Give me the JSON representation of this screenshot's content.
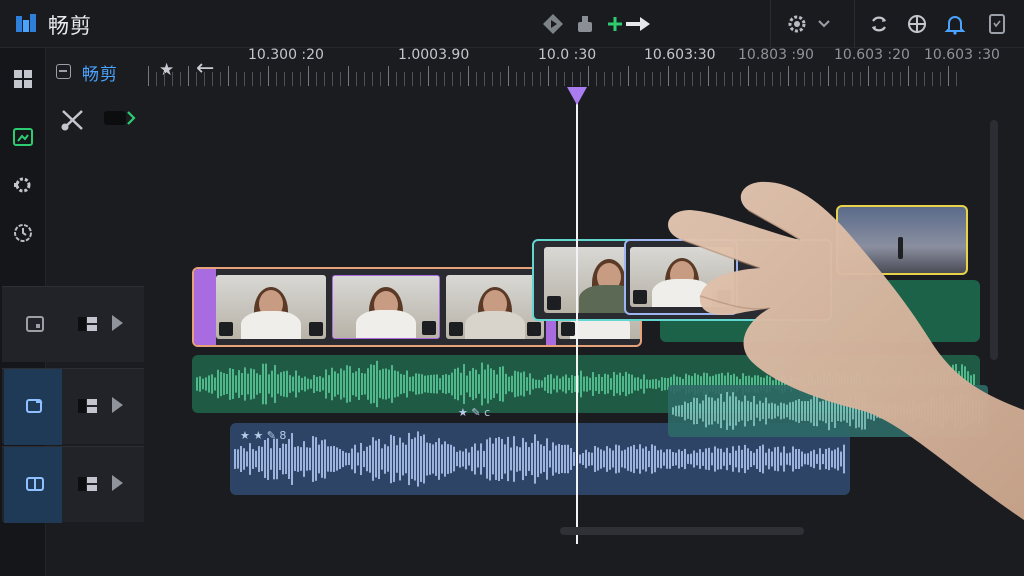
{
  "app": {
    "title": "畅剪",
    "logo_icon": "app-logo-icon"
  },
  "toolbar": {
    "icons": [
      "play-circle-icon",
      "export-icon",
      "add-transition-icon",
      "settings-gear-icon",
      "chevron-down-icon",
      "sync-icon",
      "crosshair-icon",
      "notification-bell-icon",
      "document-icon"
    ],
    "accent_green": "#2ecc71",
    "accent_blue": "#4aa3ff"
  },
  "sidebar": {
    "items": [
      {
        "icon": "grid-icon",
        "active": false
      },
      {
        "icon": "media-icon",
        "active": true
      },
      {
        "icon": "effects-gear-icon",
        "active": false
      },
      {
        "icon": "clock-badge-icon",
        "active": false
      }
    ]
  },
  "project": {
    "name": "畅剪",
    "star": "★",
    "back": "←"
  },
  "ruler": {
    "labels": [
      "10.300 :20",
      "1.0003.90",
      "10.0 :30",
      "10.603:30",
      "10.803 :90",
      "10.603 :20",
      "10.603 :30"
    ]
  },
  "tracks": {
    "video": {
      "icon": "video-track-icon"
    },
    "audio1": {
      "icon": "audio-track-icon"
    },
    "audio2": {
      "icon": "music-track-icon"
    }
  },
  "audio_labels": {
    "blue_clip": "★ ★ ✎ 8",
    "hl_clip": "★ ✎ ϲ"
  },
  "colors": {
    "playhead": "#a97cf0",
    "clip_orange": "#e8a27a",
    "clip_purple": "#a96ce0",
    "clip_cyan": "#63d6d0",
    "clip_yellow": "#e8d24a",
    "clip_selected": "#9db5f0"
  }
}
